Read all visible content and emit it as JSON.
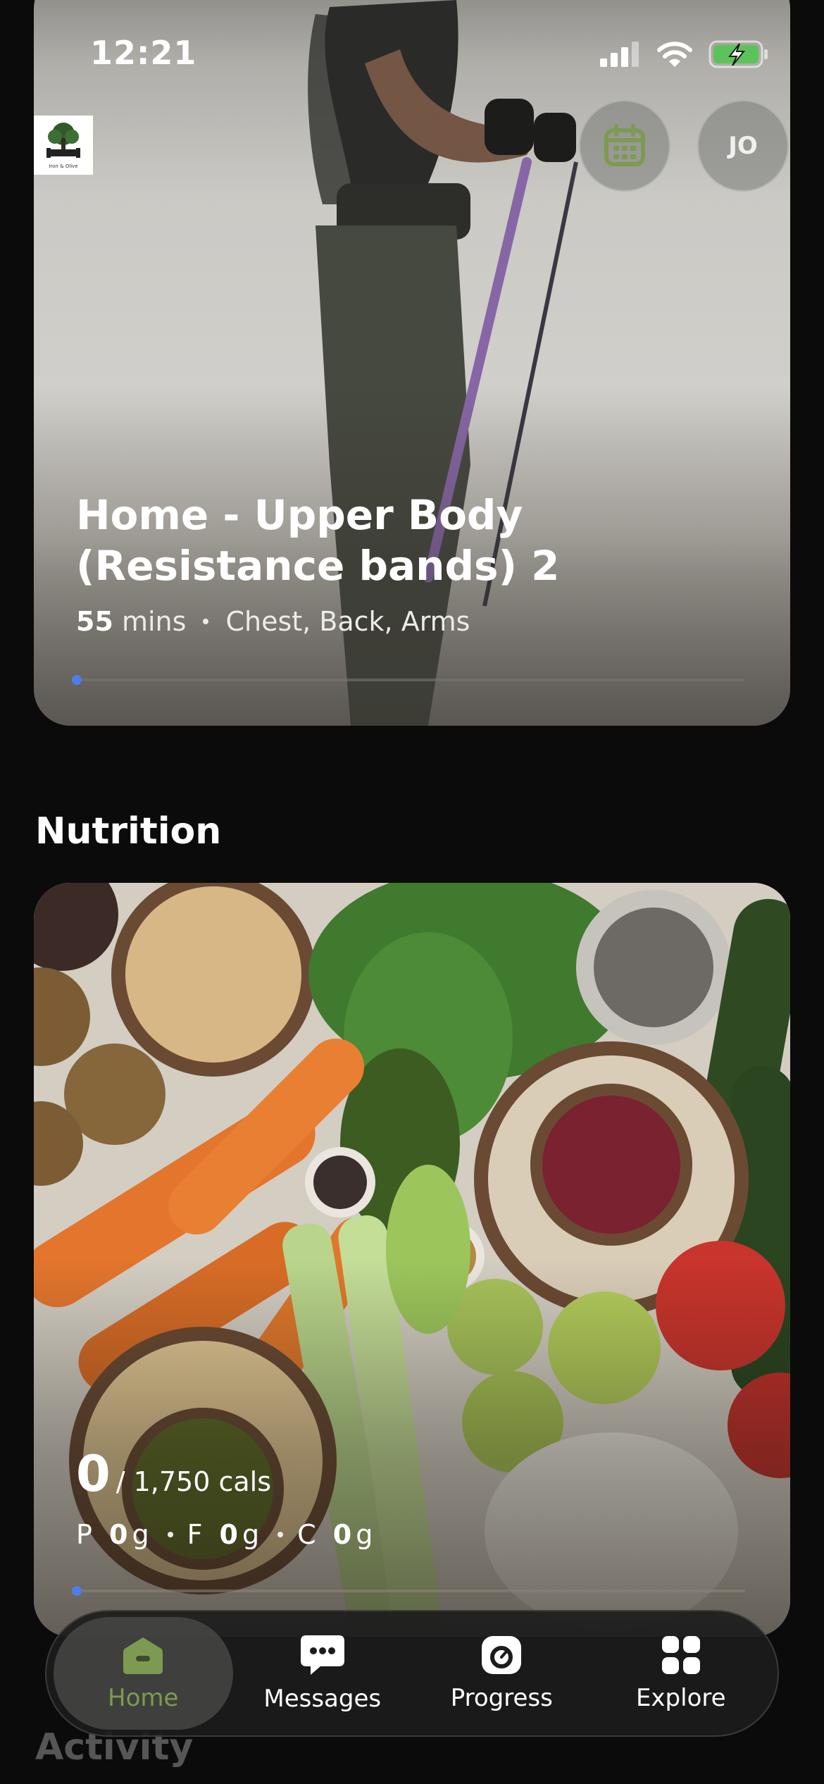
{
  "status_bar": {
    "time": "12:21"
  },
  "header": {
    "logo_text": "Iron & Olive",
    "avatar_initials": "JO"
  },
  "workout": {
    "title": "Home - Upper Body (Resistance bands) 2",
    "duration_value": "55",
    "duration_unit": "mins",
    "muscles": "Chest, Back, Arms",
    "progress": 0
  },
  "nutrition": {
    "section_title": "Nutrition",
    "calories_current": "0",
    "calories_target": "/ 1,750 cals",
    "macros": [
      {
        "letter": "P",
        "value": "0",
        "unit": "g"
      },
      {
        "letter": "F",
        "value": "0",
        "unit": "g"
      },
      {
        "letter": "C",
        "value": "0",
        "unit": "g"
      }
    ],
    "progress": 0
  },
  "next_section_title": "Activity",
  "tabbar": {
    "items": [
      {
        "label": "Home",
        "icon": "home-icon",
        "active": true
      },
      {
        "label": "Messages",
        "icon": "messages-icon",
        "active": false
      },
      {
        "label": "Progress",
        "icon": "progress-icon",
        "active": false
      },
      {
        "label": "Explore",
        "icon": "explore-icon",
        "active": false
      }
    ]
  },
  "colors": {
    "accent_green": "#7d9a52",
    "progress_blue": "#4f7de9",
    "background": "#0b0b0b"
  }
}
